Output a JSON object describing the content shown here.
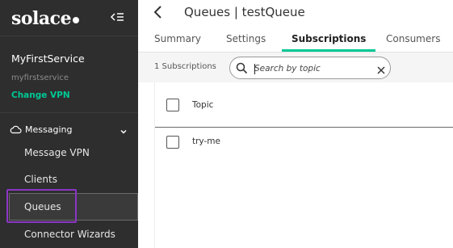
{
  "sidebar": {
    "logo_text": "solace",
    "service_name": "MyFirstService",
    "service_id": "myfirstservice",
    "change_vpn_label": "Change VPN",
    "section_label": "Messaging",
    "items": [
      {
        "label": "Message VPN",
        "active": false
      },
      {
        "label": "Clients",
        "active": false
      },
      {
        "label": "Queues",
        "active": true
      },
      {
        "label": "Connector Wizards",
        "active": false
      }
    ],
    "highlight_color": "#8b35c6",
    "accent_color": "#00c895"
  },
  "header": {
    "title": "Queues | testQueue"
  },
  "tabs": [
    {
      "label": "Summary",
      "active": false
    },
    {
      "label": "Settings",
      "active": false
    },
    {
      "label": "Subscriptions",
      "active": true
    },
    {
      "label": "Consumers",
      "active": false
    }
  ],
  "toolbar": {
    "count_label": "1 Subscriptions",
    "search_placeholder": "Search by topic",
    "search_value": ""
  },
  "table": {
    "column_header": "Topic",
    "rows": [
      {
        "topic": "try-me"
      }
    ]
  },
  "icons": {
    "logo": "solace-logo",
    "collapse": "collapse-sidebar-icon",
    "cloud": "cloud-icon",
    "chevron": "chevron-down-icon",
    "back": "chevron-left-icon",
    "search": "search-icon",
    "clear": "close-icon"
  }
}
